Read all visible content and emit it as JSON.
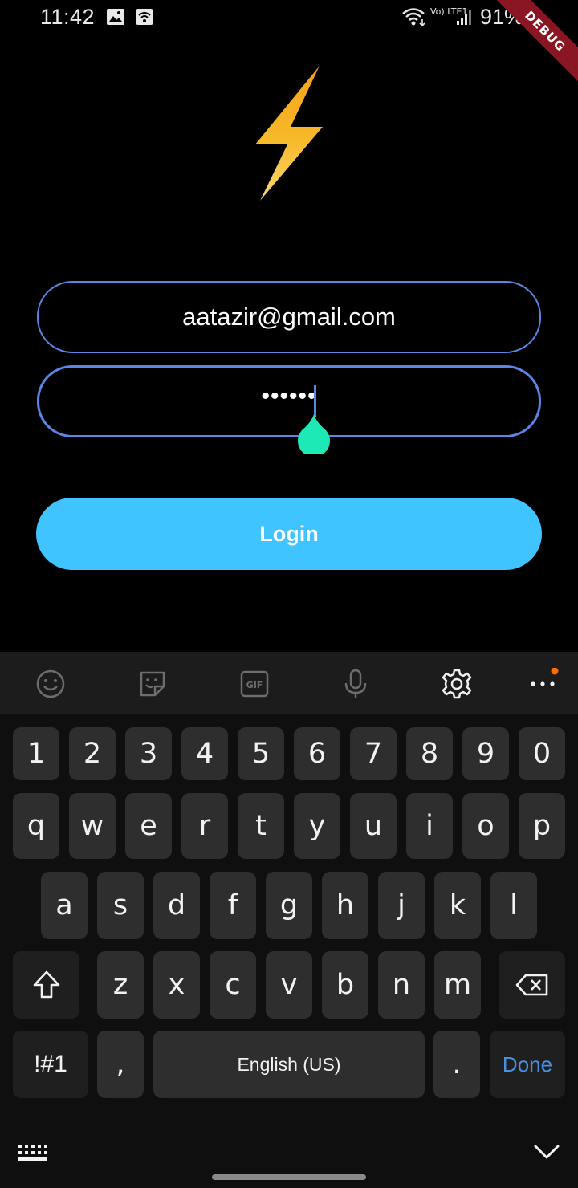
{
  "status_bar": {
    "time": "11:42",
    "battery": "91%",
    "network": "Vo) LTE1",
    "debug_banner": "DEBUG"
  },
  "login": {
    "email_value": "aatazir@gmail.com",
    "password_masked": "••••••",
    "login_label": "Login"
  },
  "keyboard": {
    "number_row": [
      "1",
      "2",
      "3",
      "4",
      "5",
      "6",
      "7",
      "8",
      "9",
      "0"
    ],
    "row_q": [
      "q",
      "w",
      "e",
      "r",
      "t",
      "y",
      "u",
      "i",
      "o",
      "p"
    ],
    "row_a": [
      "a",
      "s",
      "d",
      "f",
      "g",
      "h",
      "j",
      "k",
      "l"
    ],
    "row_z": [
      "z",
      "x",
      "c",
      "v",
      "b",
      "n",
      "m"
    ],
    "symbols_label": "!#1",
    "comma_label": ",",
    "space_label": "English (US)",
    "period_label": ".",
    "done_label": "Done",
    "toolbar_icons": [
      "emoji-icon",
      "sticker-icon",
      "gif-icon",
      "mic-icon",
      "settings-icon",
      "more-icon"
    ]
  },
  "colors": {
    "accent_blue": "#5b86e5",
    "login_button": "#40c4ff",
    "handle_teal": "#1de9b6",
    "done_blue": "#4a90e2",
    "notification_dot": "#ff6d00"
  }
}
